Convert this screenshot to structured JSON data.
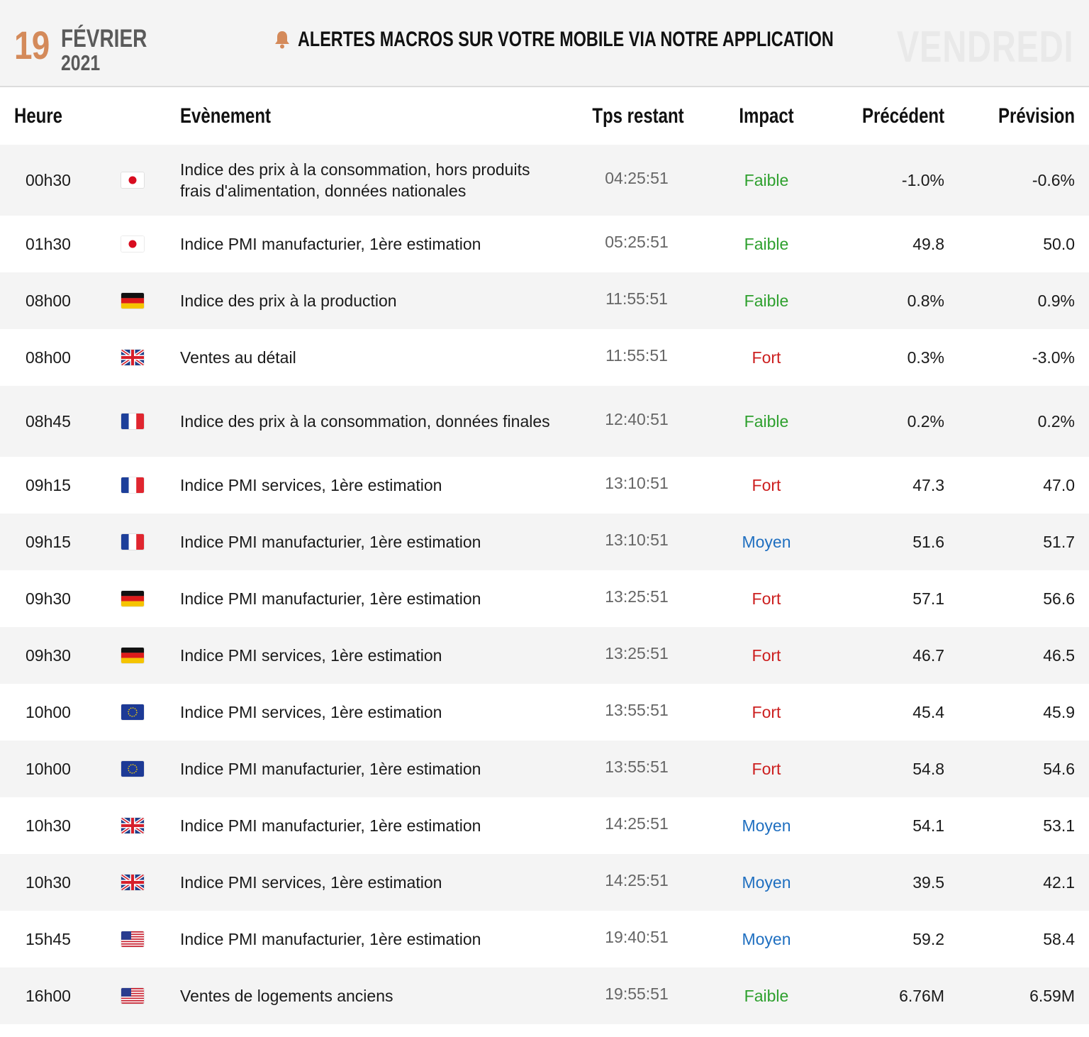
{
  "banner": {
    "day": "19",
    "month": "FÉVRIER",
    "year": "2021",
    "alert_text": "ALERTES MACROS SUR VOTRE MOBILE VIA NOTRE APPLICATION",
    "alert_icon": "bell-icon",
    "weekday": "VENDREDI"
  },
  "columns": {
    "time": "Heure",
    "event": "Evènement",
    "remaining": "Tps restant",
    "impact": "Impact",
    "previous": "Précédent",
    "forecast": "Prévision"
  },
  "impact_colors": {
    "Faible": "#2ea02e",
    "Fort": "#cc1f1f",
    "Moyen": "#1f6fc0"
  },
  "rows": [
    {
      "time": "00h30",
      "flag": "jp",
      "event": "Indice des prix à la consommation, hors produits frais d'alimentation, données nationales",
      "remaining": "04:25:51",
      "impact": "Faible",
      "previous": "-1.0%",
      "forecast": "-0.6%"
    },
    {
      "time": "01h30",
      "flag": "jp",
      "event": "Indice PMI manufacturier, 1ère estimation",
      "remaining": "05:25:51",
      "impact": "Faible",
      "previous": "49.8",
      "forecast": "50.0"
    },
    {
      "time": "08h00",
      "flag": "de",
      "event": "Indice des prix à la production",
      "remaining": "11:55:51",
      "impact": "Faible",
      "previous": "0.8%",
      "forecast": "0.9%"
    },
    {
      "time": "08h00",
      "flag": "gb",
      "event": "Ventes au détail",
      "remaining": "11:55:51",
      "impact": "Fort",
      "previous": "0.3%",
      "forecast": "-3.0%"
    },
    {
      "time": "08h45",
      "flag": "fr",
      "event": "Indice des prix à la consommation, données finales",
      "remaining": "12:40:51",
      "impact": "Faible",
      "previous": "0.2%",
      "forecast": "0.2%"
    },
    {
      "time": "09h15",
      "flag": "fr",
      "event": "Indice PMI services, 1ère estimation",
      "remaining": "13:10:51",
      "impact": "Fort",
      "previous": "47.3",
      "forecast": "47.0"
    },
    {
      "time": "09h15",
      "flag": "fr",
      "event": "Indice PMI manufacturier, 1ère estimation",
      "remaining": "13:10:51",
      "impact": "Moyen",
      "previous": "51.6",
      "forecast": "51.7"
    },
    {
      "time": "09h30",
      "flag": "de",
      "event": "Indice PMI manufacturier, 1ère estimation",
      "remaining": "13:25:51",
      "impact": "Fort",
      "previous": "57.1",
      "forecast": "56.6"
    },
    {
      "time": "09h30",
      "flag": "de",
      "event": "Indice PMI services, 1ère estimation",
      "remaining": "13:25:51",
      "impact": "Fort",
      "previous": "46.7",
      "forecast": "46.5"
    },
    {
      "time": "10h00",
      "flag": "eu",
      "event": "Indice PMI services, 1ère estimation",
      "remaining": "13:55:51",
      "impact": "Fort",
      "previous": "45.4",
      "forecast": "45.9"
    },
    {
      "time": "10h00",
      "flag": "eu",
      "event": "Indice PMI manufacturier, 1ère estimation",
      "remaining": "13:55:51",
      "impact": "Fort",
      "previous": "54.8",
      "forecast": "54.6"
    },
    {
      "time": "10h30",
      "flag": "gb",
      "event": "Indice PMI manufacturier, 1ère estimation",
      "remaining": "14:25:51",
      "impact": "Moyen",
      "previous": "54.1",
      "forecast": "53.1"
    },
    {
      "time": "10h30",
      "flag": "gb",
      "event": "Indice PMI services, 1ère estimation",
      "remaining": "14:25:51",
      "impact": "Moyen",
      "previous": "39.5",
      "forecast": "42.1"
    },
    {
      "time": "15h45",
      "flag": "us",
      "event": "Indice PMI manufacturier, 1ère estimation",
      "remaining": "19:40:51",
      "impact": "Moyen",
      "previous": "59.2",
      "forecast": "58.4"
    },
    {
      "time": "16h00",
      "flag": "us",
      "event": "Ventes de logements anciens",
      "remaining": "19:55:51",
      "impact": "Faible",
      "previous": "6.76M",
      "forecast": "6.59M"
    }
  ]
}
